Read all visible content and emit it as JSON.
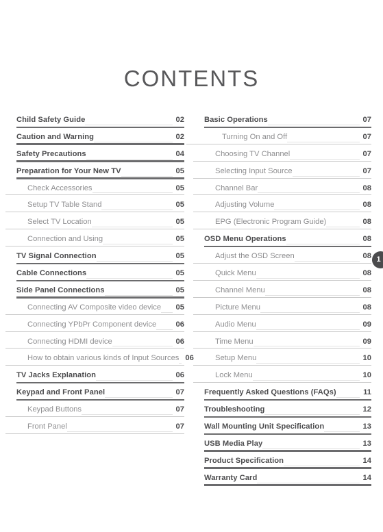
{
  "document": {
    "title": "CONTENTS"
  },
  "page_badge": {
    "number": "1"
  },
  "columns": {
    "left": {
      "entries": [
        {
          "level": 1,
          "label": "Child Safety Guide",
          "page": "02"
        },
        {
          "level": 1,
          "label": "Caution and Warning",
          "page": "02"
        },
        {
          "level": 1,
          "label": "Safety Precautions",
          "page": "04"
        },
        {
          "level": 1,
          "label": "Preparation for Your New TV",
          "page": "05"
        },
        {
          "level": 2,
          "label": "Check Accessories",
          "page": "05"
        },
        {
          "level": 2,
          "label": "Setup TV Table Stand",
          "page": "05"
        },
        {
          "level": 2,
          "label": "Select TV Location",
          "page": "05"
        },
        {
          "level": 2,
          "label": "Connection and Using",
          "page": "05"
        },
        {
          "level": 1,
          "label": "TV Signal Connection",
          "page": "05"
        },
        {
          "level": 1,
          "label": "Cable Connections",
          "page": "05"
        },
        {
          "level": 1,
          "label": "Side Panel Connections",
          "page": "05"
        },
        {
          "level": 2,
          "label": "Connecting AV Composite video device",
          "page": "05"
        },
        {
          "level": 2,
          "label": "Connecting YPbPr Component device",
          "page": "06"
        },
        {
          "level": 2,
          "label": "Connecting HDMI device",
          "page": "06"
        },
        {
          "level": 2,
          "label": "How to obtain various kinds of Input Sources",
          "page": "06"
        },
        {
          "level": 1,
          "label": "TV Jacks Explanation",
          "page": "06"
        },
        {
          "level": 1,
          "label": "Keypad and Front Panel",
          "page": "07"
        },
        {
          "level": 2,
          "label": "Keypad Buttons",
          "page": "07"
        },
        {
          "level": 2,
          "label": "Front Panel",
          "page": "07"
        }
      ]
    },
    "right": {
      "entries": [
        {
          "level": 1,
          "label": "Basic Operations",
          "page": "07"
        },
        {
          "level": 2,
          "deep": true,
          "label": "Turning On and Off",
          "page": "07"
        },
        {
          "level": 2,
          "label": "Choosing TV Channel",
          "page": "07"
        },
        {
          "level": 2,
          "label": "Selecting Input Source",
          "page": "07"
        },
        {
          "level": 2,
          "label": "Channel Bar",
          "page": "08"
        },
        {
          "level": 2,
          "label": "Adjusting Volume",
          "page": "08"
        },
        {
          "level": 2,
          "label": "EPG (Electronic Program Guide)",
          "page": "08"
        },
        {
          "level": 1,
          "label": "OSD Menu Operations",
          "page": "08"
        },
        {
          "level": 2,
          "label": "Adjust the OSD Screen",
          "page": "08"
        },
        {
          "level": 2,
          "label": "Quick Menu",
          "page": "08"
        },
        {
          "level": 2,
          "label": "Channel Menu",
          "page": "08"
        },
        {
          "level": 2,
          "label": "Picture Menu",
          "page": "08"
        },
        {
          "level": 2,
          "label": "Audio Menu",
          "page": "09"
        },
        {
          "level": 2,
          "label": "Time Menu",
          "page": "09"
        },
        {
          "level": 2,
          "label": "Setup Menu",
          "page": "10"
        },
        {
          "level": 2,
          "label": "Lock Menu",
          "page": "10"
        },
        {
          "level": 1,
          "label": "Frequently Asked Questions (FAQs)",
          "page": "11"
        },
        {
          "level": 1,
          "label": "Troubleshooting",
          "page": "12"
        },
        {
          "level": 1,
          "label": "Wall Mounting Unit Specification",
          "page": "13"
        },
        {
          "level": 1,
          "label": "USB Media Play",
          "page": "13"
        },
        {
          "level": 1,
          "label": "Product Specification",
          "page": "14"
        },
        {
          "level": 1,
          "label": "Warranty Card",
          "page": "14"
        }
      ]
    }
  }
}
